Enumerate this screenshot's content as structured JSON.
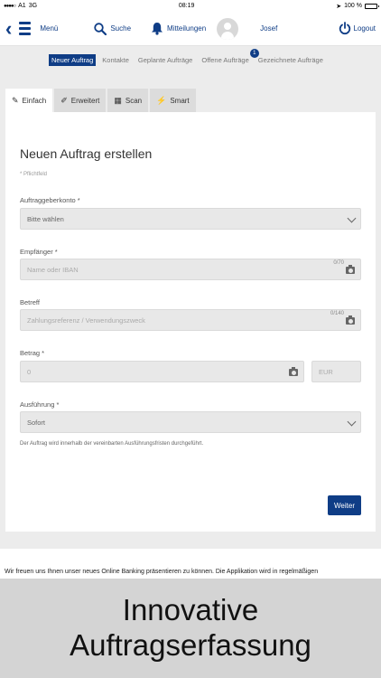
{
  "status_bar": {
    "carrier": "A1",
    "network": "3G",
    "time": "08:19",
    "battery": "100 %",
    "battery_level": 1.0
  },
  "topbar": {
    "menu_label": "Menü",
    "search_label": "Suche",
    "notifications_label": "Mitteilungen",
    "user_name": "Josef",
    "logout_label": "Logout"
  },
  "subnav": {
    "items": [
      {
        "label": "Neuer Auftrag"
      },
      {
        "label": "Kontakte"
      },
      {
        "label": "Geplante Aufträge"
      },
      {
        "label": "Offene Aufträge"
      },
      {
        "label": "Gezeichnete Aufträge"
      }
    ],
    "open_orders_badge": "1"
  },
  "tabs": [
    {
      "label": "Einfach"
    },
    {
      "label": "Erweitert"
    },
    {
      "label": "Scan"
    },
    {
      "label": "Smart"
    }
  ],
  "form": {
    "title": "Neuen Auftrag erstellen",
    "required_note": "* Pflichtfeld",
    "account": {
      "label": "Auftraggeberkonto *",
      "value": "Bitte wählen"
    },
    "recipient": {
      "label": "Empfänger *",
      "placeholder": "Name oder IBAN",
      "counter": "0/70"
    },
    "reference": {
      "label": "Betreff",
      "placeholder": "Zahlungsreferenz / Verwendungszweck",
      "counter": "0/140"
    },
    "amount": {
      "label": "Betrag *",
      "placeholder": "0",
      "currency": "EUR"
    },
    "execution": {
      "label": "Ausführung *",
      "value": "Sofort"
    },
    "help_text": "Der Auftrag wird innerhalb der vereinbarten Ausführungsfristen durchgeführt.",
    "submit_label": "Weiter"
  },
  "footer_text": "Wir freuen uns Ihnen unser neues Online Banking präsentieren zu können. Die Applikation wird in regelmäßigen",
  "caption": {
    "line1": "Innovative",
    "line2": "Auftragserfassung"
  },
  "colors": {
    "accent": "#0f3d86",
    "battery": "#2ecc40"
  }
}
